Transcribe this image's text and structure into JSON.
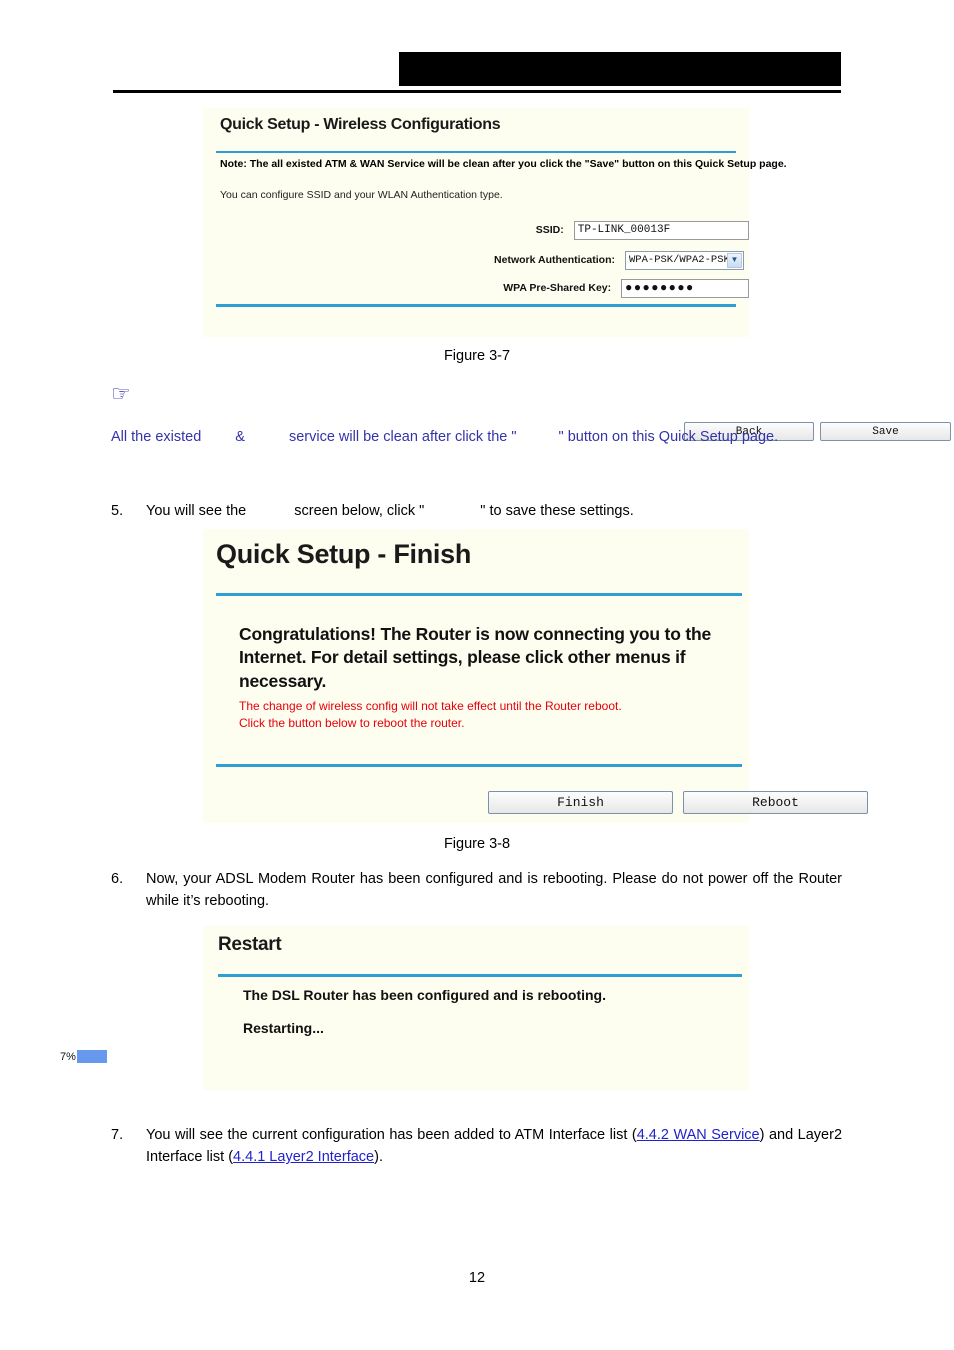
{
  "header": {
    "redacted_block": "",
    "rule": ""
  },
  "figure_3_7": {
    "title": "Quick Setup - Wireless Configurations",
    "note": "Note: The all existed ATM & WAN Service will be clean after you click the \"Save\" button on this Quick Setup page.",
    "description": "You can configure SSID and your WLAN Authentication type.",
    "fields": [
      {
        "label": "SSID:",
        "value": "TP-LINK_00013F",
        "type": "text"
      },
      {
        "label": "Network Authentication:",
        "value": "WPA-PSK/WPA2-PSK",
        "type": "select"
      },
      {
        "label": "WPA Pre-Shared Key:",
        "value": "●●●●●●●●",
        "type": "password"
      }
    ],
    "buttons": {
      "back": "Back",
      "save": "Save"
    },
    "caption": "Figure 3-7",
    "select_arrow_glyph": "▼"
  },
  "note_block": {
    "hand_glyph": "☞",
    "text_part_1": "All the existed",
    "text_part_2": "&",
    "text_part_3": "service will be clean after click the \"",
    "text_part_4": "\" button on this Quick Setup page."
  },
  "item_5": {
    "number": "5.",
    "text_part_1": "You will see the",
    "text_part_2": "screen below, click \"",
    "text_part_3": "\" to save these settings."
  },
  "figure_3_8": {
    "title": "Quick Setup - Finish",
    "congratulations": "Congratulations! The Router is now connecting you to the Internet. For detail settings, please click other menus if necessary.",
    "warning_line_1": "The change of wireless config will not take effect until the Router reboot.",
    "warning_line_2": "Click the button below to reboot the router.",
    "buttons": {
      "finish": "Finish",
      "reboot": "Reboot"
    },
    "caption": "Figure 3-8"
  },
  "item_6": {
    "number": "6.",
    "text": "Now, your ADSL Modem Router has been configured and is rebooting. Please do not power off the Router while it’s rebooting."
  },
  "restart_panel": {
    "title": "Restart",
    "line_1": "The DSL Router has been configured and is rebooting.",
    "line_2": "Restarting...",
    "progress_label": "7%",
    "progress_percent": 7,
    "progress_color": "#6699ee"
  },
  "item_7": {
    "number": "7.",
    "text_before": "You will see the current configuration has been added to ATM Interface list (",
    "link_1": "4.4.2 WAN Service",
    "text_middle": ") and Layer2 Interface list (",
    "link_2": "4.4.1 Layer2 Interface",
    "text_after": ")."
  },
  "page_number": "12",
  "colors": {
    "panel_background": "#fdfdf0",
    "accent_rule": "#2e9fd4",
    "note_text": "#3333aa",
    "warning_text": "#e8000a",
    "link": "#2222cc",
    "progress": "#6699ee"
  }
}
